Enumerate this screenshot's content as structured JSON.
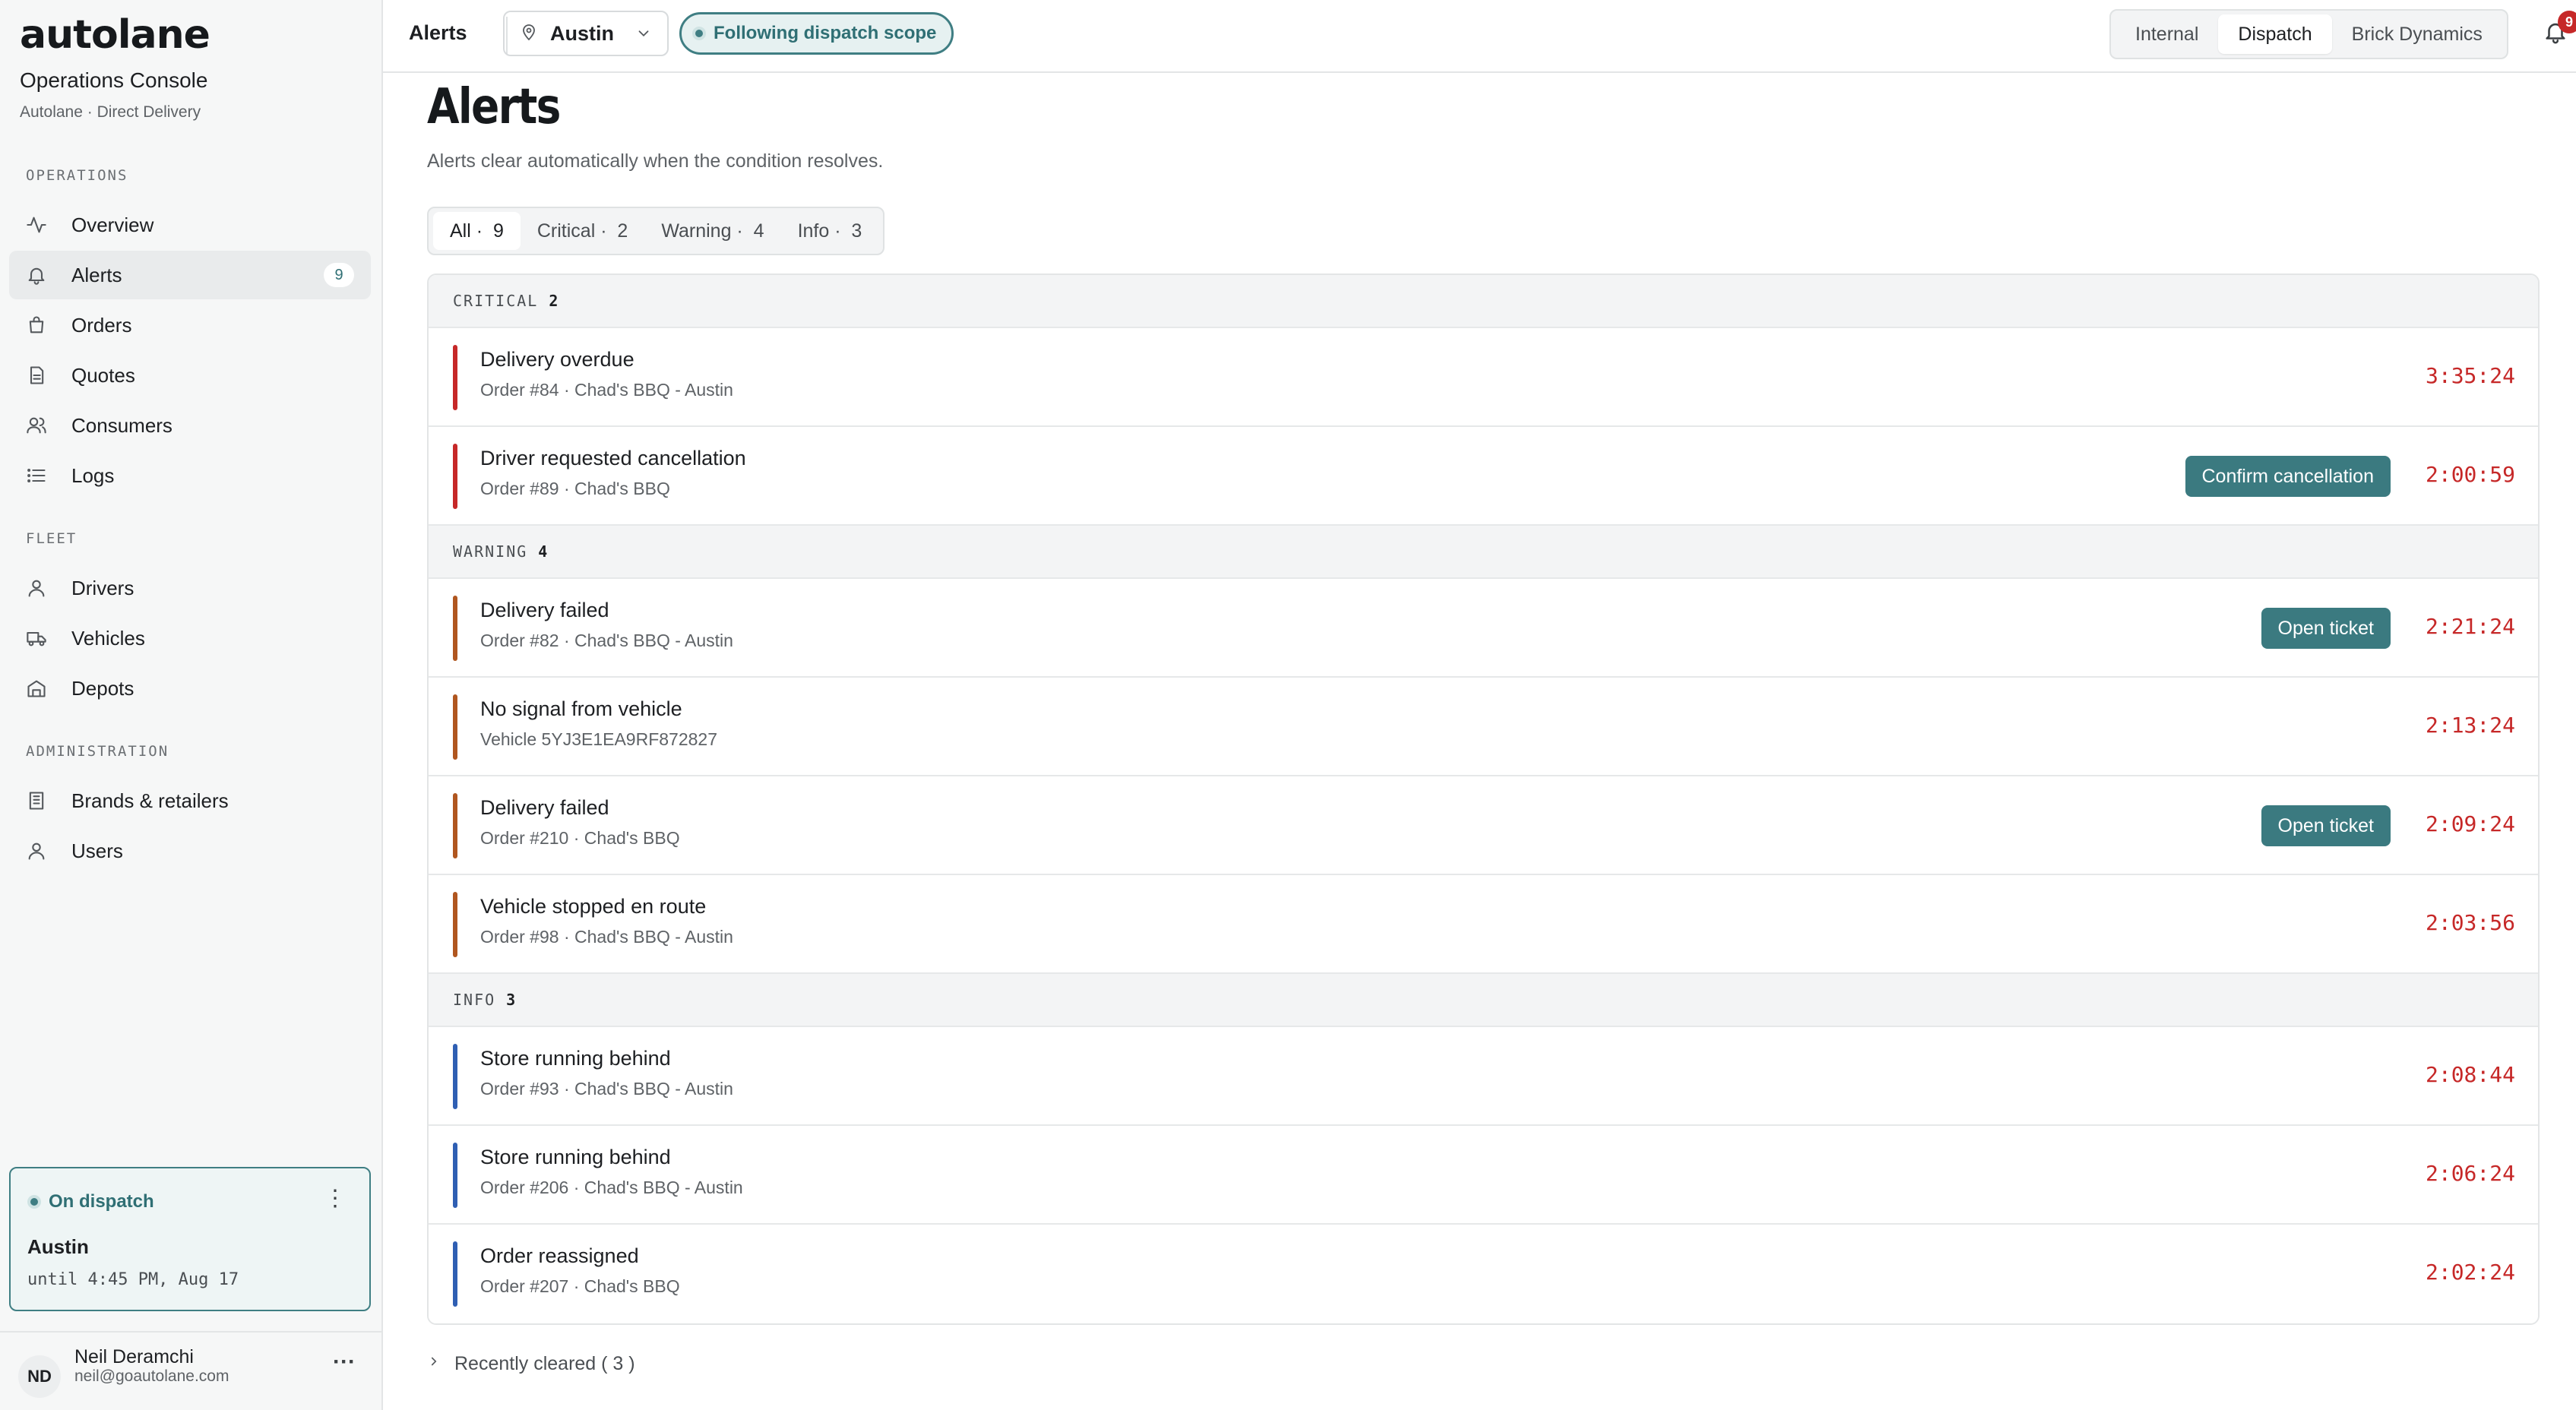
{
  "app": {
    "logo": "autolane",
    "title": "Operations Console",
    "subtitle": "Autolane · Direct Delivery"
  },
  "sidebar": {
    "sections": [
      {
        "label": "OPERATIONS"
      },
      {
        "label": "FLEET"
      },
      {
        "label": "ADMINISTRATION"
      }
    ],
    "items": [
      {
        "label": "Overview",
        "icon": "activity-icon"
      },
      {
        "label": "Alerts",
        "icon": "bell-icon",
        "badge": "9",
        "active": true
      },
      {
        "label": "Orders",
        "icon": "bag-icon"
      },
      {
        "label": "Quotes",
        "icon": "document-icon"
      },
      {
        "label": "Consumers",
        "icon": "users-icon"
      },
      {
        "label": "Logs",
        "icon": "list-icon"
      },
      {
        "label": "Drivers",
        "icon": "user-icon"
      },
      {
        "label": "Vehicles",
        "icon": "truck-icon"
      },
      {
        "label": "Depots",
        "icon": "warehouse-icon"
      },
      {
        "label": "Brands & retailers",
        "icon": "building-icon"
      },
      {
        "label": "Users",
        "icon": "user-icon"
      }
    ],
    "dispatch": {
      "status": "On dispatch",
      "city": "Austin",
      "until": "until 4:45 PM, Aug 17"
    },
    "user": {
      "initials": "ND",
      "name": "Neil Deramchi",
      "email": "neil@goautolane.com",
      "more": "···"
    }
  },
  "topbar": {
    "breadcrumb": "Alerts",
    "city": "Austin",
    "scope": "Following dispatch scope",
    "segments": [
      {
        "label": "Internal"
      },
      {
        "label": "Dispatch",
        "active": true
      },
      {
        "label": "Brick Dynamics"
      }
    ],
    "notifications": "9"
  },
  "page": {
    "title": "Alerts",
    "description": "Alerts clear automatically when the condition resolves.",
    "filters": [
      {
        "label": "All ·  9",
        "active": true
      },
      {
        "label": "Critical ·  2"
      },
      {
        "label": "Warning ·  4"
      },
      {
        "label": "Info ·  3"
      }
    ]
  },
  "groups": [
    {
      "name": "CRITICAL",
      "count": "2",
      "color": "#c62828",
      "alerts": [
        {
          "title": "Delivery overdue",
          "sub": "Order #84 · Chad's BBQ - Austin",
          "timer": "3:35:24"
        },
        {
          "title": "Driver requested cancellation",
          "sub": "Order #89 · Chad's BBQ",
          "timer": "2:00:59",
          "action": "Confirm cancellation"
        }
      ]
    },
    {
      "name": "WARNING",
      "count": "4",
      "color": "#b0561f",
      "alerts": [
        {
          "title": "Delivery failed",
          "sub": "Order #82 · Chad's BBQ - Austin",
          "timer": "2:21:24",
          "action": "Open ticket"
        },
        {
          "title": "No signal from vehicle",
          "sub": "Vehicle 5YJ3E1EA9RF872827",
          "timer": "2:13:24"
        },
        {
          "title": "Delivery failed",
          "sub": "Order #210 · Chad's BBQ",
          "timer": "2:09:24",
          "action": "Open ticket"
        },
        {
          "title": "Vehicle stopped en route",
          "sub": "Order #98 · Chad's BBQ - Austin",
          "timer": "2:03:56"
        }
      ]
    },
    {
      "name": "INFO",
      "count": "3",
      "color": "#2f5fb3",
      "alerts": [
        {
          "title": "Store running behind",
          "sub": "Order #93 · Chad's BBQ - Austin",
          "timer": "2:08:44"
        },
        {
          "title": "Store running behind",
          "sub": "Order #206 · Chad's BBQ - Austin",
          "timer": "2:06:24"
        },
        {
          "title": "Order reassigned",
          "sub": "Order #207 · Chad's BBQ",
          "timer": "2:02:24"
        }
      ]
    }
  ],
  "recent": {
    "label": "Recently cleared ( 3 )"
  }
}
